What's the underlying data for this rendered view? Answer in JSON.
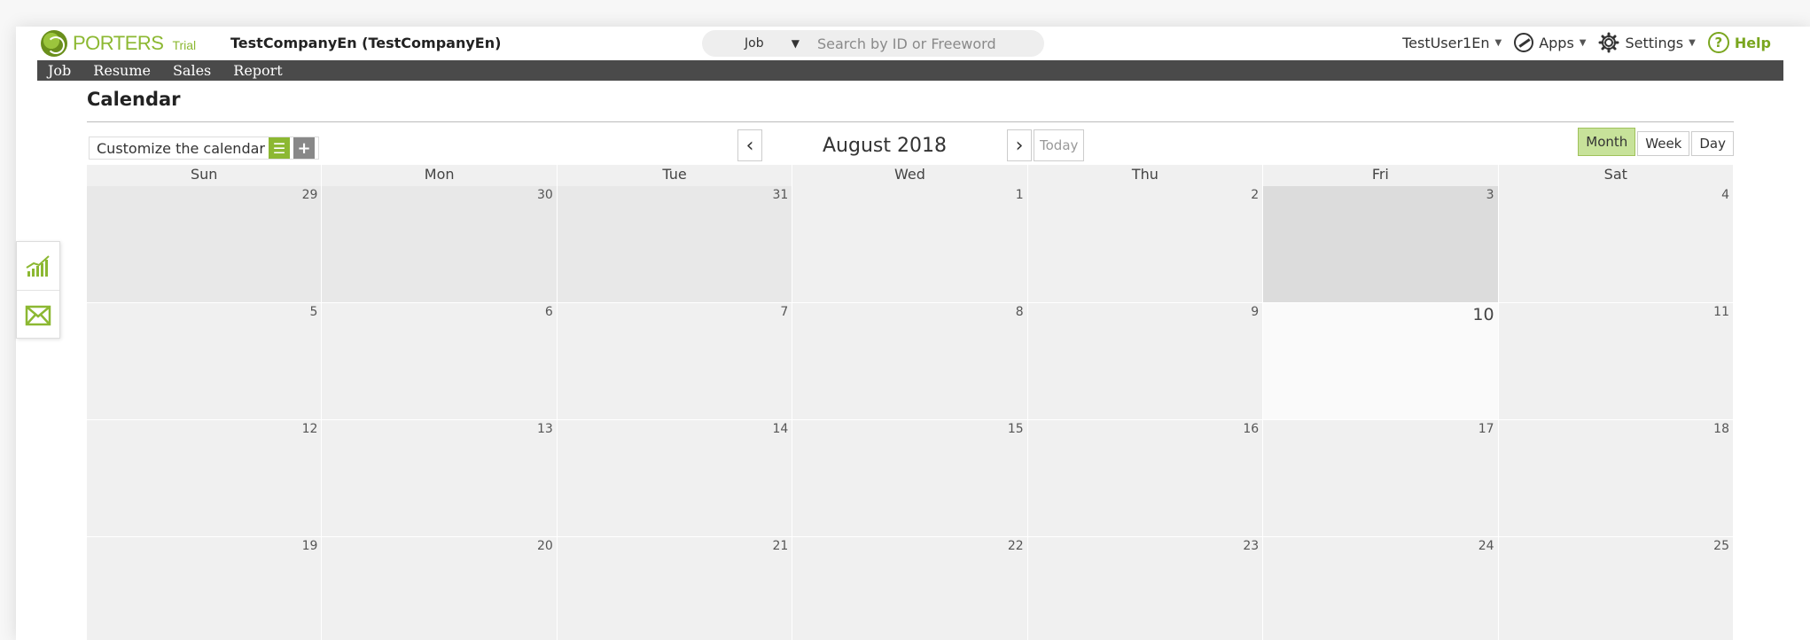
{
  "header": {
    "logo_text": "PORTERS",
    "trial": "Trial",
    "company": "TestCompanyEn (TestCompanyEn)",
    "search_type": "Job",
    "search_placeholder": "Search by ID or Freeword",
    "user": "TestUser1En",
    "apps": "Apps",
    "settings": "Settings",
    "help": "Help"
  },
  "nav": {
    "items": [
      "Job",
      "Resume",
      "Sales",
      "Report"
    ]
  },
  "calendar": {
    "title": "Calendar",
    "customize": "Customize the calendar",
    "month": "August 2018",
    "today": "Today",
    "views": {
      "month": "Month",
      "week": "Week",
      "day": "Day"
    },
    "weekdays": [
      "Sun",
      "Mon",
      "Tue",
      "Wed",
      "Thu",
      "Fri",
      "Sat"
    ],
    "weeks": [
      [
        "29",
        "30",
        "31",
        "1",
        "2",
        "3",
        "4"
      ],
      [
        "5",
        "6",
        "7",
        "8",
        "9",
        "10",
        "11"
      ],
      [
        "12",
        "13",
        "14",
        "15",
        "16",
        "17",
        "18"
      ],
      [
        "19",
        "20",
        "21",
        "22",
        "23",
        "24",
        "25"
      ]
    ]
  },
  "colors": {
    "brand_green": "#8cb832",
    "nav_bg": "#4a4a4a"
  }
}
